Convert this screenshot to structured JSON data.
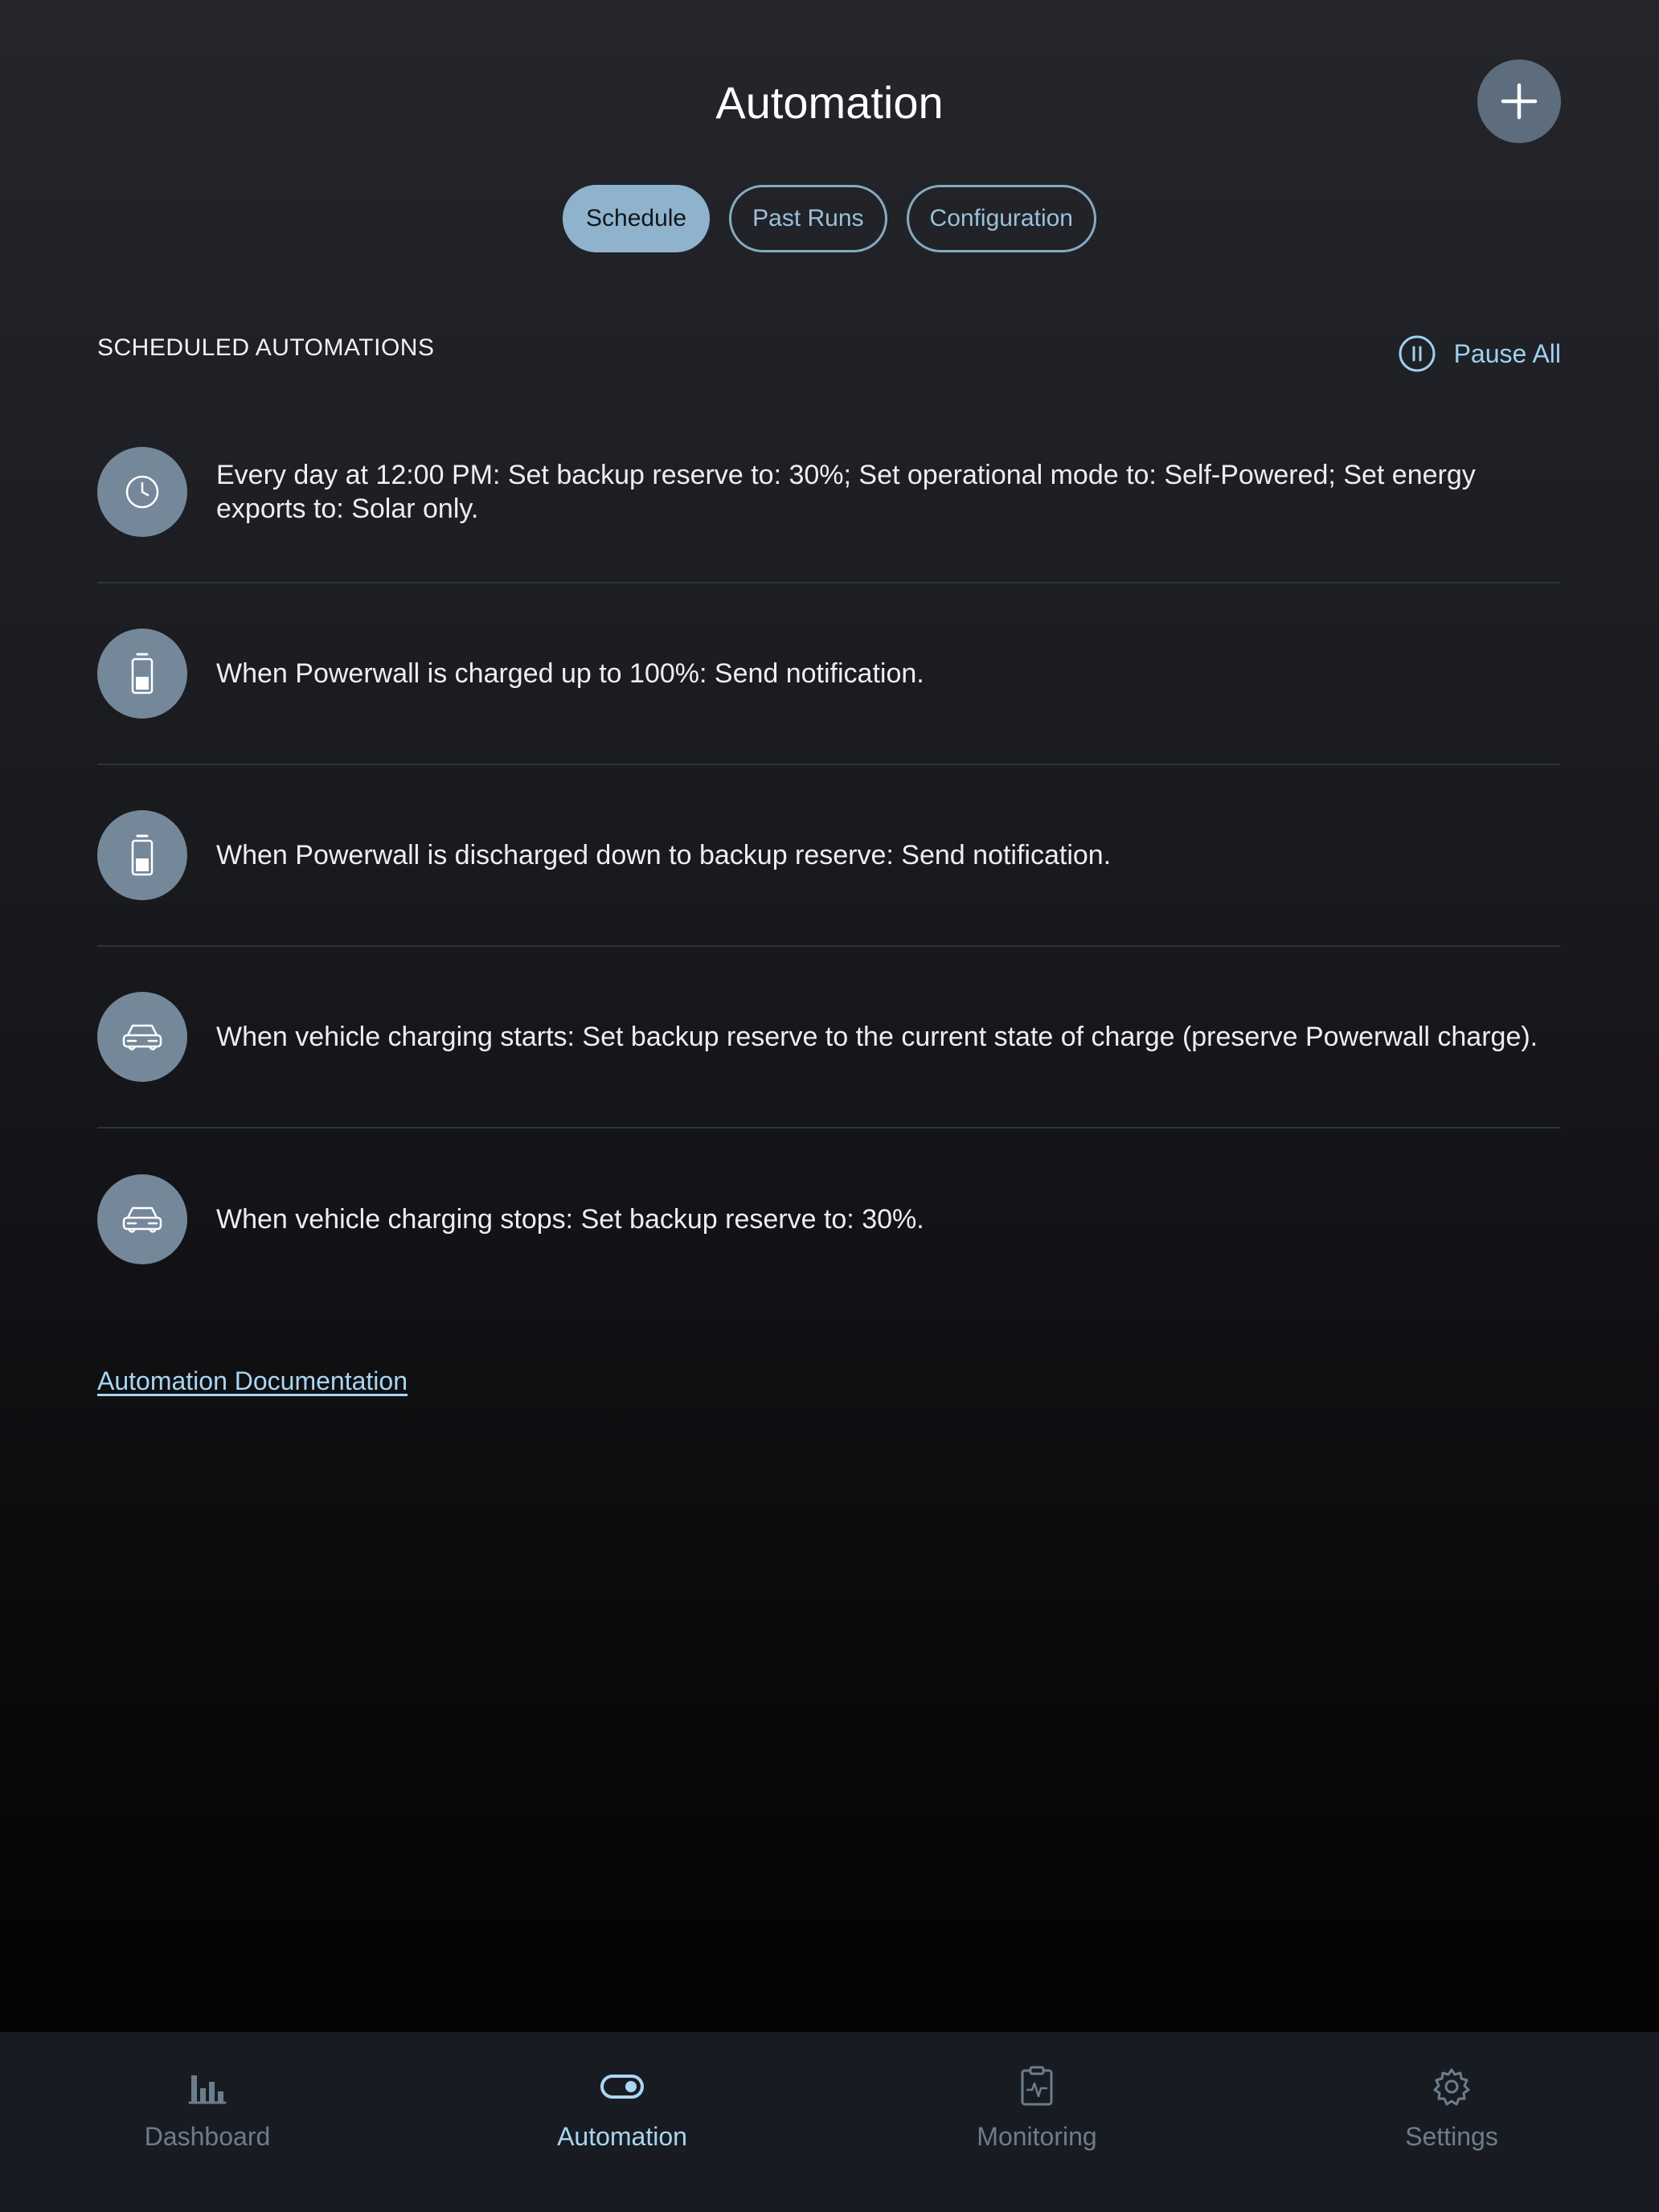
{
  "header": {
    "title": "Automation",
    "add_icon": "plus-icon"
  },
  "tabs": [
    {
      "label": "Schedule",
      "active": true
    },
    {
      "label": "Past Runs",
      "active": false
    },
    {
      "label": "Configuration",
      "active": false
    }
  ],
  "section": {
    "label": "SCHEDULED AUTOMATIONS",
    "pause_all_label": "Pause All",
    "pause_icon": "pause-circle-icon"
  },
  "automations": [
    {
      "icon": "clock-icon",
      "text": "Every day at 12:00 PM: Set backup reserve to: 30%; Set operational mode to: Self-Powered; Set energy exports to: Solar only."
    },
    {
      "icon": "battery-icon",
      "text": "When Powerwall is charged up to 100%: Send notification."
    },
    {
      "icon": "battery-icon",
      "text": "When Powerwall is discharged down to backup reserve: Send notification."
    },
    {
      "icon": "car-icon",
      "text": "When vehicle charging starts: Set backup reserve to the current state of charge (preserve Powerwall charge)."
    },
    {
      "icon": "car-icon",
      "text": "When vehicle charging stops: Set backup reserve to: 30%."
    }
  ],
  "footer_link": "Automation Documentation",
  "tabbar": [
    {
      "label": "Dashboard",
      "icon": "bar-chart-icon",
      "active": false
    },
    {
      "label": "Automation",
      "icon": "toggle-icon",
      "active": true
    },
    {
      "label": "Monitoring",
      "icon": "clipboard-pulse-icon",
      "active": false
    },
    {
      "label": "Settings",
      "icon": "gear-icon",
      "active": false
    }
  ],
  "colors": {
    "accent": "#a9d6f2",
    "active_tab_bg": "#8fb3cd",
    "avatar_bg": "#75889a",
    "add_button_bg": "#5d6d7d"
  }
}
